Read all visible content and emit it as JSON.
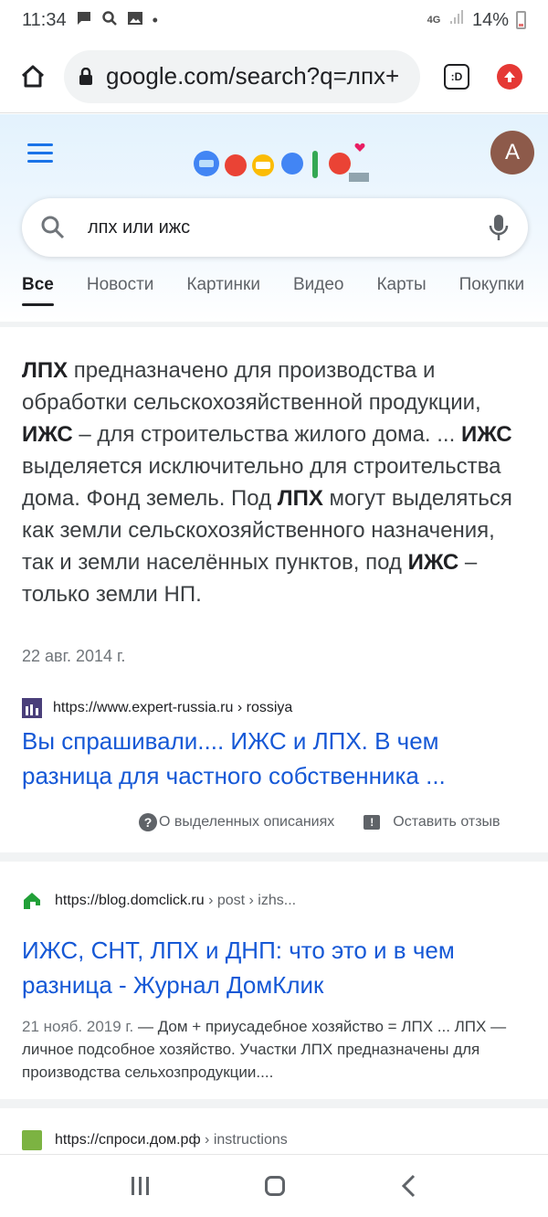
{
  "status_bar": {
    "time": "11:34",
    "network": "4G",
    "battery": "14%"
  },
  "browser": {
    "url": "google.com/search?q=лпх+",
    "tabs_label": ":D"
  },
  "google": {
    "avatar_letter": "A",
    "search_query": "лпх или ижс",
    "tabs": [
      "Все",
      "Новости",
      "Картинки",
      "Видео",
      "Карты",
      "Покупки"
    ]
  },
  "featured": {
    "snippet": [
      {
        "t": "ЛПХ",
        "b": true
      },
      {
        "t": " предназначено для производства и обработки сельскохозяйственной продукции, ",
        "b": false
      },
      {
        "t": "ИЖС",
        "b": true
      },
      {
        "t": " – для строительства жилого дома. ... ",
        "b": false
      },
      {
        "t": "ИЖС",
        "b": true
      },
      {
        "t": " выделяется исключительно для строительства дома. Фонд земель. Под ",
        "b": false
      },
      {
        "t": "ЛПХ",
        "b": true
      },
      {
        "t": " могут выделяться как земли сельскохозяйственного назначения, так и земли населённых пунктов, под ",
        "b": false
      },
      {
        "t": "ИЖС",
        "b": true
      },
      {
        "t": " – только земли НП.",
        "b": false
      }
    ],
    "date": "22 авг. 2014 г.",
    "source_url": "https://www.expert-russia.ru › rossiya",
    "title": "Вы спрашивали.... ИЖС и ЛПХ. В чем разница для частного собственника ...",
    "about_label": "О выделенных описаниях",
    "feedback_label": "Оставить отзыв"
  },
  "result2": {
    "source_domain": "https://blog.domclick.ru",
    "source_path": " › post › izhs...",
    "title": "ИЖС, СНТ, ЛПХ и ДНП: что это и в чем разница - Журнал ДомКлик",
    "date": "21 нояб. 2019 г.",
    "description": " — Дом + приусадебное хозяйство = ЛПХ ... ЛПХ — личное подсобное хозяйство. Участки ЛПХ предназначены для производства сельхозпродукции...."
  },
  "result3": {
    "source_domain": "https://спроси.дом.рф",
    "source_path": " › instructions"
  },
  "colors": {
    "link": "#1558d6",
    "accent": "#1a73e8",
    "avatar": "#8d5a4a"
  }
}
